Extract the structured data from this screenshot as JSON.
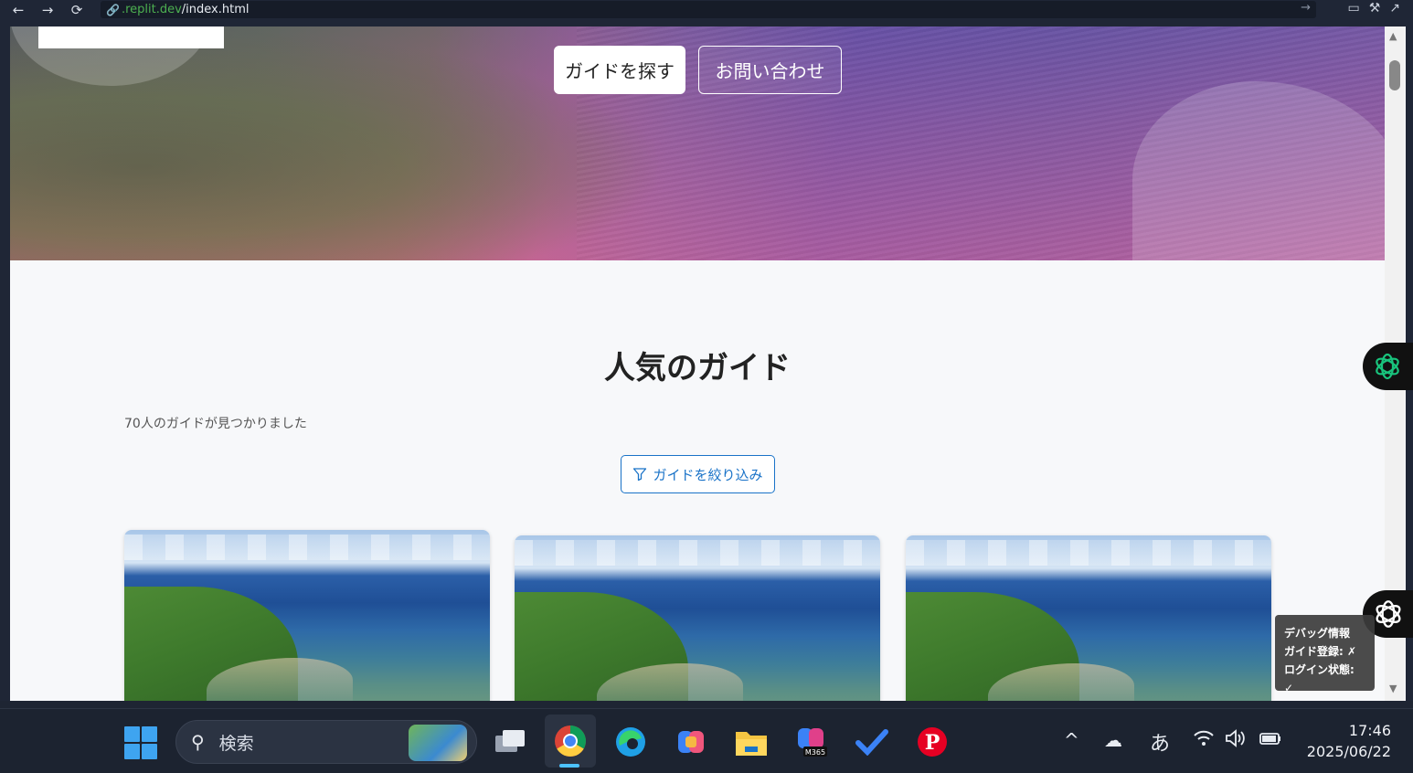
{
  "browser": {
    "url_host": ".replit.dev",
    "url_path": "/index.html"
  },
  "hero": {
    "find_button": "ガイドを探す",
    "contact_button": "お問い合わせ"
  },
  "main": {
    "title": "人気のガイド",
    "count_text": "70人のガイドが見つかりました",
    "filter_button": "ガイドを絞り込み"
  },
  "debug": {
    "title": "デバッグ情報",
    "line1": "ガイド登録: ✗",
    "line2": "ログイン状態: ✓"
  },
  "taskbar": {
    "search_placeholder": "検索",
    "ime_indicator": "あ",
    "time": "17:46",
    "date": "2025/06/22"
  },
  "colors": {
    "accent": "#1a73c8",
    "taskbar_bg": "#1c2330"
  }
}
